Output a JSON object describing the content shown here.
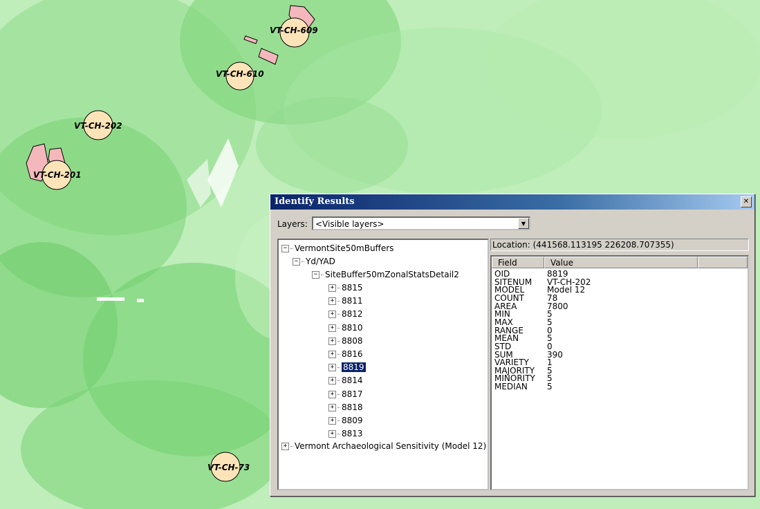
{
  "map": {
    "sites": [
      {
        "label": "VT-CH-609"
      },
      {
        "label": "VT-CH-610"
      },
      {
        "label": "VT-CH-202"
      },
      {
        "label": "VT-CH-201"
      },
      {
        "label": "VT-CH-73"
      }
    ],
    "colors": {
      "background": "#bfeebb",
      "buffer_fill": "#fde4b8",
      "polygon_fill": "#f4b8bc"
    }
  },
  "dialog": {
    "title": "Identify Results",
    "close_icon": "close-icon",
    "layers_label": "Layers:",
    "layers_value": "<Visible layers>",
    "tree": {
      "root": "VermontSite50mBuffers",
      "group": "Yd/YAD",
      "table": "SiteBuffer50mZonalStatsDetail2",
      "items": [
        "8815",
        "8811",
        "8812",
        "8810",
        "8808",
        "8816",
        "8819",
        "8814",
        "8817",
        "8818",
        "8809",
        "8813"
      ],
      "selected": "8819",
      "other_layer": "Vermont Archaeological Sensitivity (Model 12)"
    },
    "location": "Location: (441568.113195  226208.707355)",
    "columns": [
      "Field",
      "Value"
    ],
    "rows": [
      {
        "field": "OID",
        "value": "8819"
      },
      {
        "field": "SITENUM",
        "value": "VT-CH-202"
      },
      {
        "field": "MODEL",
        "value": "Model 12"
      },
      {
        "field": "COUNT",
        "value": "78"
      },
      {
        "field": "AREA",
        "value": "7800"
      },
      {
        "field": "MIN",
        "value": "5"
      },
      {
        "field": "MAX",
        "value": "5"
      },
      {
        "field": "RANGE",
        "value": "0"
      },
      {
        "field": "MEAN",
        "value": "5"
      },
      {
        "field": "STD",
        "value": "0"
      },
      {
        "field": "SUM",
        "value": "390"
      },
      {
        "field": "VARIETY",
        "value": "1"
      },
      {
        "field": "MAJORITY",
        "value": "5"
      },
      {
        "field": "MINORITY",
        "value": "5"
      },
      {
        "field": "MEDIAN",
        "value": "5"
      }
    ],
    "colors": {
      "title_start": "#0a246a",
      "title_end": "#a6caf0",
      "selection": "#0a246a",
      "chrome": "#d4d0c8"
    }
  }
}
